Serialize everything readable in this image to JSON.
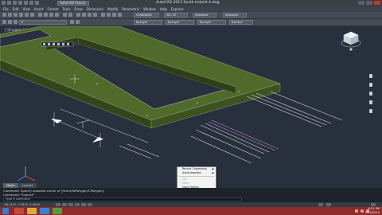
{
  "titlebar": {
    "workspace": "AutoCAD Classic",
    "title": "AutoCAD 2013    South Ireland 4.dwg"
  },
  "menu": [
    "File",
    "Edit",
    "View",
    "Insert",
    "Format",
    "Tools",
    "Draw",
    "Dimension",
    "Modify",
    "Parametric",
    "Window",
    "Help",
    "Express"
  ],
  "toolbar": {
    "workspace_combo": "AutoCAD Classic",
    "layer_combo": "0",
    "textstyle_combo": "STANDARD",
    "dimstyle_combo": "ISO-25",
    "tablestyle_combo": "Standard",
    "multileader_combo": "Standard",
    "color_combo": "ByLayer",
    "linetype_combo": "ByLayer",
    "lineweight_combo": "ByLayer",
    "plotstyle_combo": "ByColor"
  },
  "viewport_label": "[-][Custom View][Realistic]",
  "context_menu": {
    "items": [
      {
        "label": "Recent Commands",
        "disabled": false,
        "arrow": true
      },
      {
        "label": "AutoComplete",
        "disabled": false,
        "arrow": true
      },
      {
        "label": "Cut",
        "disabled": true
      },
      {
        "label": "Copy",
        "disabled": true
      },
      {
        "label": "Copy History",
        "disabled": false
      },
      {
        "label": "Paste",
        "disabled": true
      },
      {
        "label": "Paste to CommandLine",
        "disabled": true
      },
      {
        "label": "Options...",
        "disabled": false
      }
    ]
  },
  "tabs": [
    "Model",
    "Layout1"
  ],
  "command": {
    "line1": "Command: Specify opposite corner or [Fence/WPolygon/CPolygon]:",
    "line2": "Command: *Cancel*",
    "prompt": "Type a command"
  },
  "status": {
    "coords": "-18.1421, 7.3415, 0.0000"
  },
  "clock": {
    "time": "6:51 PM",
    "date": "1/19/2014"
  },
  "colors": {
    "canvas": "#27303c",
    "wall_top": "#4f6a2a",
    "wall_side": "#33461b",
    "taskbar": "#8e2b2b"
  }
}
